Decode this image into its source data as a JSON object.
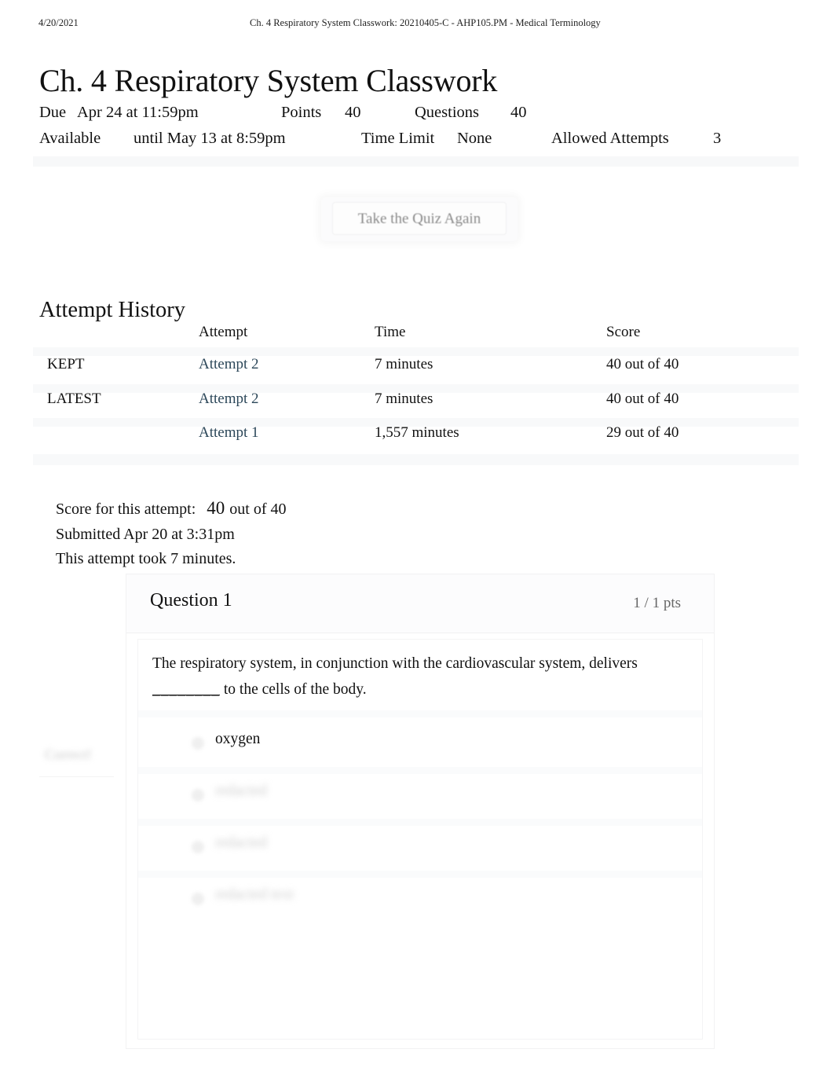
{
  "print_header": {
    "date": "4/20/2021",
    "title": "Ch. 4 Respiratory System Classwork: 20210405-C - AHP105.PM - Medical Terminology"
  },
  "page_title": "Ch. 4 Respiratory System Classwork",
  "quiz_meta": {
    "due_label": "Due",
    "due_value": "Apr 24 at 11:59pm",
    "points_label": "Points",
    "points_value": "40",
    "questions_label": "Questions",
    "questions_value": "40",
    "available_label": "Available",
    "available_value": "until May 13 at 8:59pm",
    "time_limit_label": "Time Limit",
    "time_limit_value": "None",
    "allowed_attempts_label": "Allowed Attempts",
    "allowed_attempts_value": "3"
  },
  "retake_button": "Take the Quiz Again",
  "attempt_history": {
    "heading": "Attempt History",
    "columns": {
      "label": "",
      "attempt": "Attempt",
      "time": "Time",
      "score": "Score"
    },
    "rows": [
      {
        "label": "KEPT",
        "attempt": "Attempt 2",
        "time": "7 minutes",
        "score": "40 out of 40"
      },
      {
        "label": "LATEST",
        "attempt": "Attempt 2",
        "time": "7 minutes",
        "score": "40 out of 40"
      },
      {
        "label": "",
        "attempt": "Attempt 1",
        "time": "1,557 minutes",
        "score": "29 out of 40"
      }
    ]
  },
  "attempt_summary": {
    "score_prefix": "Score for this attempt:",
    "score_value": "40",
    "score_suffix": "out of 40",
    "submitted": "Submitted Apr 20 at 3:31pm",
    "duration": "This attempt took 7 minutes."
  },
  "question": {
    "title": "Question 1",
    "points": "1 / 1 pts",
    "text_before_blank": "The respiratory system, in conjunction with the cardiovascular system, delivers",
    "blank": "________",
    "text_after_blank": "to the cells of the body.",
    "correct_badge": "Correct!",
    "answers": [
      {
        "label": "oxygen",
        "redacted": false
      },
      {
        "label": "redacted",
        "redacted": true
      },
      {
        "label": "redacted",
        "redacted": true
      },
      {
        "label": "redacted text",
        "redacted": true
      }
    ]
  },
  "colors": {
    "link": "#2c4759",
    "text": "#111111",
    "muted": "#666666",
    "stripe": "#f8f9fa",
    "card_border": "#f2f2f3"
  }
}
